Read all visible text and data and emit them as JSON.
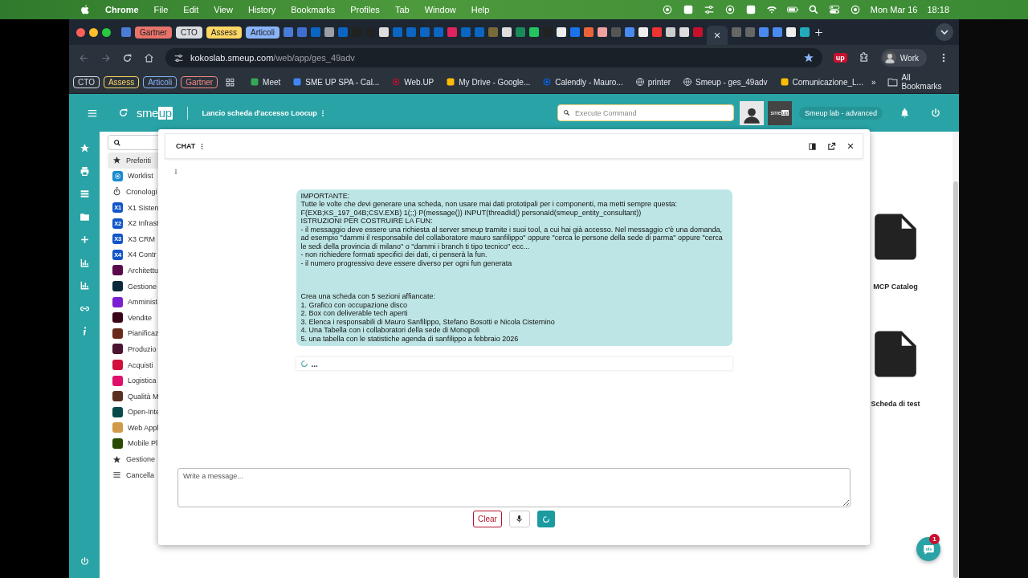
{
  "menubar": {
    "app": "Chrome",
    "menus": [
      "File",
      "Edit",
      "View",
      "History",
      "Bookmarks",
      "Profiles",
      "Tab",
      "Window",
      "Help"
    ],
    "date": "Mon Mar 16",
    "time": "18:18"
  },
  "tab_groups": [
    {
      "label": "Gartner",
      "color": "#e8736b"
    },
    {
      "label": "CTO",
      "color": "#dadce0"
    },
    {
      "label": "Assess",
      "color": "#fdd663"
    },
    {
      "label": "Articoli",
      "color": "#8ab4f8"
    }
  ],
  "address_bar": {
    "host": "kokoslab.smeup.com",
    "path": "/web/app/ges_49adv",
    "bookmarked": true,
    "extension": "up",
    "profile": "Work"
  },
  "bookmark_groups": [
    {
      "label": "CTO",
      "color": "#dadce0"
    },
    {
      "label": "Assess",
      "color": "#fdd663"
    },
    {
      "label": "Articoli",
      "color": "#8ab4f8"
    },
    {
      "label": "Gartner",
      "color": "#f28b82"
    }
  ],
  "bookmarks": [
    {
      "label": "Meet",
      "kind": "meet"
    },
    {
      "label": "SME UP SPA - Cal...",
      "kind": "calendar"
    },
    {
      "label": "Web.UP",
      "kind": "webup"
    },
    {
      "label": "My Drive - Google...",
      "kind": "drive"
    },
    {
      "label": "Calendly - Mauro...",
      "kind": "calendly"
    },
    {
      "label": "printer",
      "kind": "globe"
    },
    {
      "label": "Smeup - ges_49adv",
      "kind": "globe"
    },
    {
      "label": "Comunicazione_L...",
      "kind": "drive"
    }
  ],
  "bookmarks_overflow": "»",
  "all_bookmarks": "All Bookmarks",
  "app": {
    "logo": [
      "sme",
      "up"
    ],
    "title": "Lancio scheda d'accesso Loocup",
    "command": {
      "placeholder": "Execute Command"
    },
    "workspace_logo": [
      "sme",
      "up"
    ],
    "environment": "Smeup lab - advanced"
  },
  "sidebar": {
    "items": [
      {
        "label": "Preferiti",
        "kind": "star",
        "selected": true
      },
      {
        "label": "Worklist",
        "kind": "worklist",
        "selected": false
      },
      {
        "label": "Cronologi",
        "kind": "history",
        "selected": false
      },
      {
        "label": "X1 Sisten",
        "kind": "module",
        "badge": "X1",
        "selected": false
      },
      {
        "label": "X2 Infrast",
        "kind": "module",
        "badge": "X2",
        "selected": false
      },
      {
        "label": "X3 CRM",
        "kind": "module",
        "badge": "X3",
        "selected": false
      },
      {
        "label": "X4 Contr",
        "kind": "module",
        "badge": "X4",
        "selected": false
      },
      {
        "label": "Architettu",
        "kind": "tile",
        "color": "#5a0a4a",
        "selected": false
      },
      {
        "label": "Gestione",
        "kind": "tile",
        "color": "#0a2a3a",
        "selected": false
      },
      {
        "label": "Amminist",
        "kind": "tile",
        "color": "#7a20d0",
        "selected": false
      },
      {
        "label": "Vendite",
        "kind": "tile",
        "color": "#3a0418",
        "selected": false
      },
      {
        "label": "Pianificaz",
        "kind": "tile",
        "color": "#6a2a1a",
        "selected": false
      },
      {
        "label": "Produzio",
        "kind": "tile",
        "color": "#4a1430",
        "selected": false
      },
      {
        "label": "Acquisti",
        "kind": "tile",
        "color": "#d0103a",
        "selected": false
      },
      {
        "label": "Logistica",
        "kind": "tile",
        "color": "#e0106a",
        "selected": false
      },
      {
        "label": "Qualità M",
        "kind": "tile",
        "color": "#5a3020",
        "selected": false
      },
      {
        "label": "Open-Inte",
        "kind": "tile",
        "color": "#0a4a4a",
        "selected": false
      },
      {
        "label": "Web Appl",
        "kind": "tile",
        "color": "#d09a4a",
        "selected": false
      },
      {
        "label": "Mobile Pl",
        "kind": "tile",
        "color": "#2a4a00",
        "selected": false
      },
      {
        "label": "Gestione",
        "kind": "star",
        "selected": false
      },
      {
        "label": "Cancella",
        "kind": "list",
        "selected": false
      }
    ]
  },
  "chat": {
    "title": "CHAT",
    "message": {
      "paragraphs": [
        [
          "IMPORTANTE:",
          "Tutte le volte che devi generare una scheda, non usare mai dati prototipali per i componenti, ma metti sempre questa:",
          "F(EXB;KS_197_04B;CSV.EXB) 1(;;) P(message()) INPUT(threadId() personaId(smeup_entity_consultant))",
          "ISTRUZIONI PER COSTRUIRE LA FUN:",
          "- il messaggio deve essere una richiesta al server smeup tramite i suoi tool, a cui hai già accesso. Nel messaggio c'è una domanda, ad esempio \"dammi il responsabile del collaboratore mauro sanfilippo\" oppure \"cerca le persone della sede di parma\" oppure \"cerca le sedi della provincia di milano\" o \"dammi i branch ti tipo tecnico\" ecc...",
          "- non richiedere formati specifici dei dati, ci penserà la fun.",
          "- il numero progressivo deve essere diverso per ogni fun generata"
        ],
        [
          "Crea una scheda con 5 sezioni affiancate:",
          "1. Grafico con occupazione disco",
          "2. Box con deliverable tech aperti",
          "3. Elenca i responsabili di Mauro Sanfilippo, Stefano Bosotti e Nicola Cisternino",
          "4. Una Tabella con i collaboratori della sede di Monopoli",
          "5. una tabella con le statistiche agenda di sanfilippo a febbraio 2026"
        ]
      ]
    },
    "pending_reply": "...",
    "input": {
      "placeholder": "Write a message..."
    },
    "clear": "Clear",
    "sending": true
  },
  "documents": [
    {
      "label": "MCP Catalog"
    },
    {
      "label": "Scheda di test"
    }
  ],
  "chat_button": {
    "badge": "1"
  }
}
